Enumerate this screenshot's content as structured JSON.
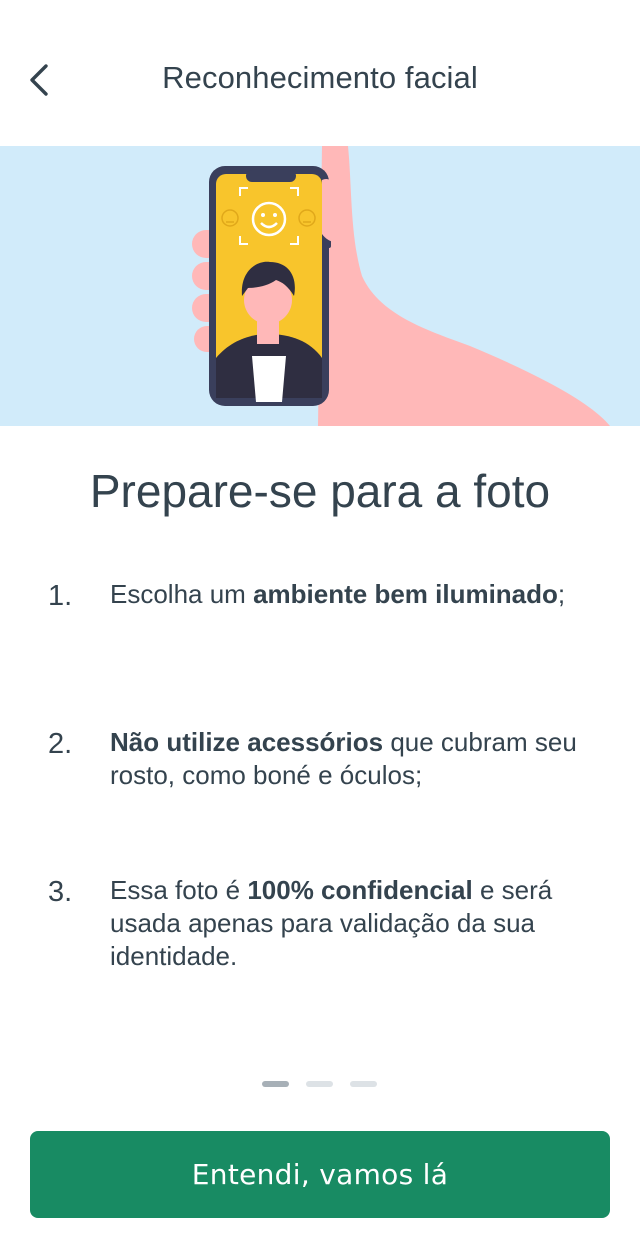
{
  "header": {
    "title": "Reconhecimento facial",
    "back_icon": "chevron-left-icon"
  },
  "illustration": {
    "description_icon": "phone-face-scan-illustration",
    "colors": {
      "background": "#d1ebfa",
      "phone_screen": "#f8c52c",
      "hand": "#ffb8b8",
      "phone_frame": "#3a3f5c"
    }
  },
  "main": {
    "heading": "Prepare-se para a foto",
    "steps": [
      {
        "number": "1.",
        "parts": [
          {
            "t": "Escolha um ",
            "b": false
          },
          {
            "t": "ambiente bem iluminado",
            "b": true
          },
          {
            "t": ";",
            "b": false
          }
        ]
      },
      {
        "number": "2.",
        "parts": [
          {
            "t": "Não utilize acessórios",
            "b": true
          },
          {
            "t": " que cubram seu rosto, como boné e óculos;",
            "b": false
          }
        ]
      },
      {
        "number": "3.",
        "parts": [
          {
            "t": "Essa foto é ",
            "b": false
          },
          {
            "t": "100% confidencial",
            "b": true
          },
          {
            "t": " e será usada apenas para validação da sua identidade.",
            "b": false
          }
        ]
      }
    ]
  },
  "pagination": {
    "total": 3,
    "active_index": 0
  },
  "footer": {
    "cta_label": "Entendi, vamos lá",
    "cta_color": "#188b63"
  }
}
